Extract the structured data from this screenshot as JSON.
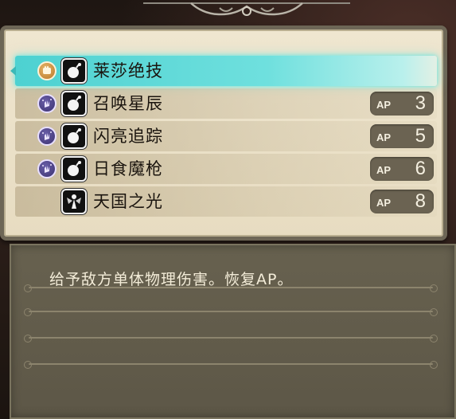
{
  "skills": [
    {
      "name": "莱莎绝技",
      "type_icon": "fist-icon",
      "skill_icon": "bomb-icon",
      "ap_label": "",
      "ap_value": "",
      "selected": true
    },
    {
      "name": "召唤星辰",
      "type_icon": "sparkle-hand-icon",
      "skill_icon": "bomb-icon",
      "ap_label": "AP",
      "ap_value": "3",
      "selected": false
    },
    {
      "name": "闪亮追踪",
      "type_icon": "sparkle-hand-icon",
      "skill_icon": "bomb-icon",
      "ap_label": "AP",
      "ap_value": "5",
      "selected": false
    },
    {
      "name": "日食魔枪",
      "type_icon": "sparkle-hand-icon",
      "skill_icon": "bomb-icon",
      "ap_label": "AP",
      "ap_value": "6",
      "selected": false
    },
    {
      "name": "天国之光",
      "type_icon": "",
      "skill_icon": "angel-icon",
      "ap_label": "AP",
      "ap_value": "8",
      "selected": false
    }
  ],
  "description": {
    "text": "给予敌方单体物理伤害。恢复AP。"
  },
  "colors": {
    "selection": "#4dd1d1",
    "panel": "#efe6d0",
    "ap_pill": "#6b6352",
    "desc_bg": "#67614f"
  }
}
